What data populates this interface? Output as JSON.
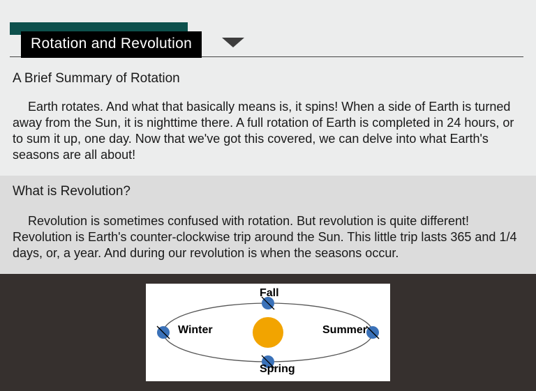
{
  "title": "Rotation and Revolution",
  "section1": {
    "heading": "A Brief Summary of Rotation",
    "body": "Earth rotates. And what that basically means is, it spins! When a side of Earth is turned away from the Sun, it is nighttime there. A full rotation of Earth is completed in 24 hours, or to sum it up, one day. Now that we've got this covered, we can delve into what Earth's seasons are all about!"
  },
  "section2": {
    "heading": "What is Revolution?",
    "body": "Revolution is sometimes confused with rotation. But revolution is quite different! Revolution is Earth's counter-clockwise trip around the Sun. This little trip lasts 365 and 1/4 days, or, a year.  And during our revolution is when the seasons occur."
  },
  "diagram": {
    "labels": {
      "top": "Fall",
      "left": "Winter",
      "right": "Summer",
      "bottom": "Spring"
    },
    "sun_color": "#f2a400",
    "earth_color": "#3a71b8",
    "orbit_stroke": "#555"
  }
}
